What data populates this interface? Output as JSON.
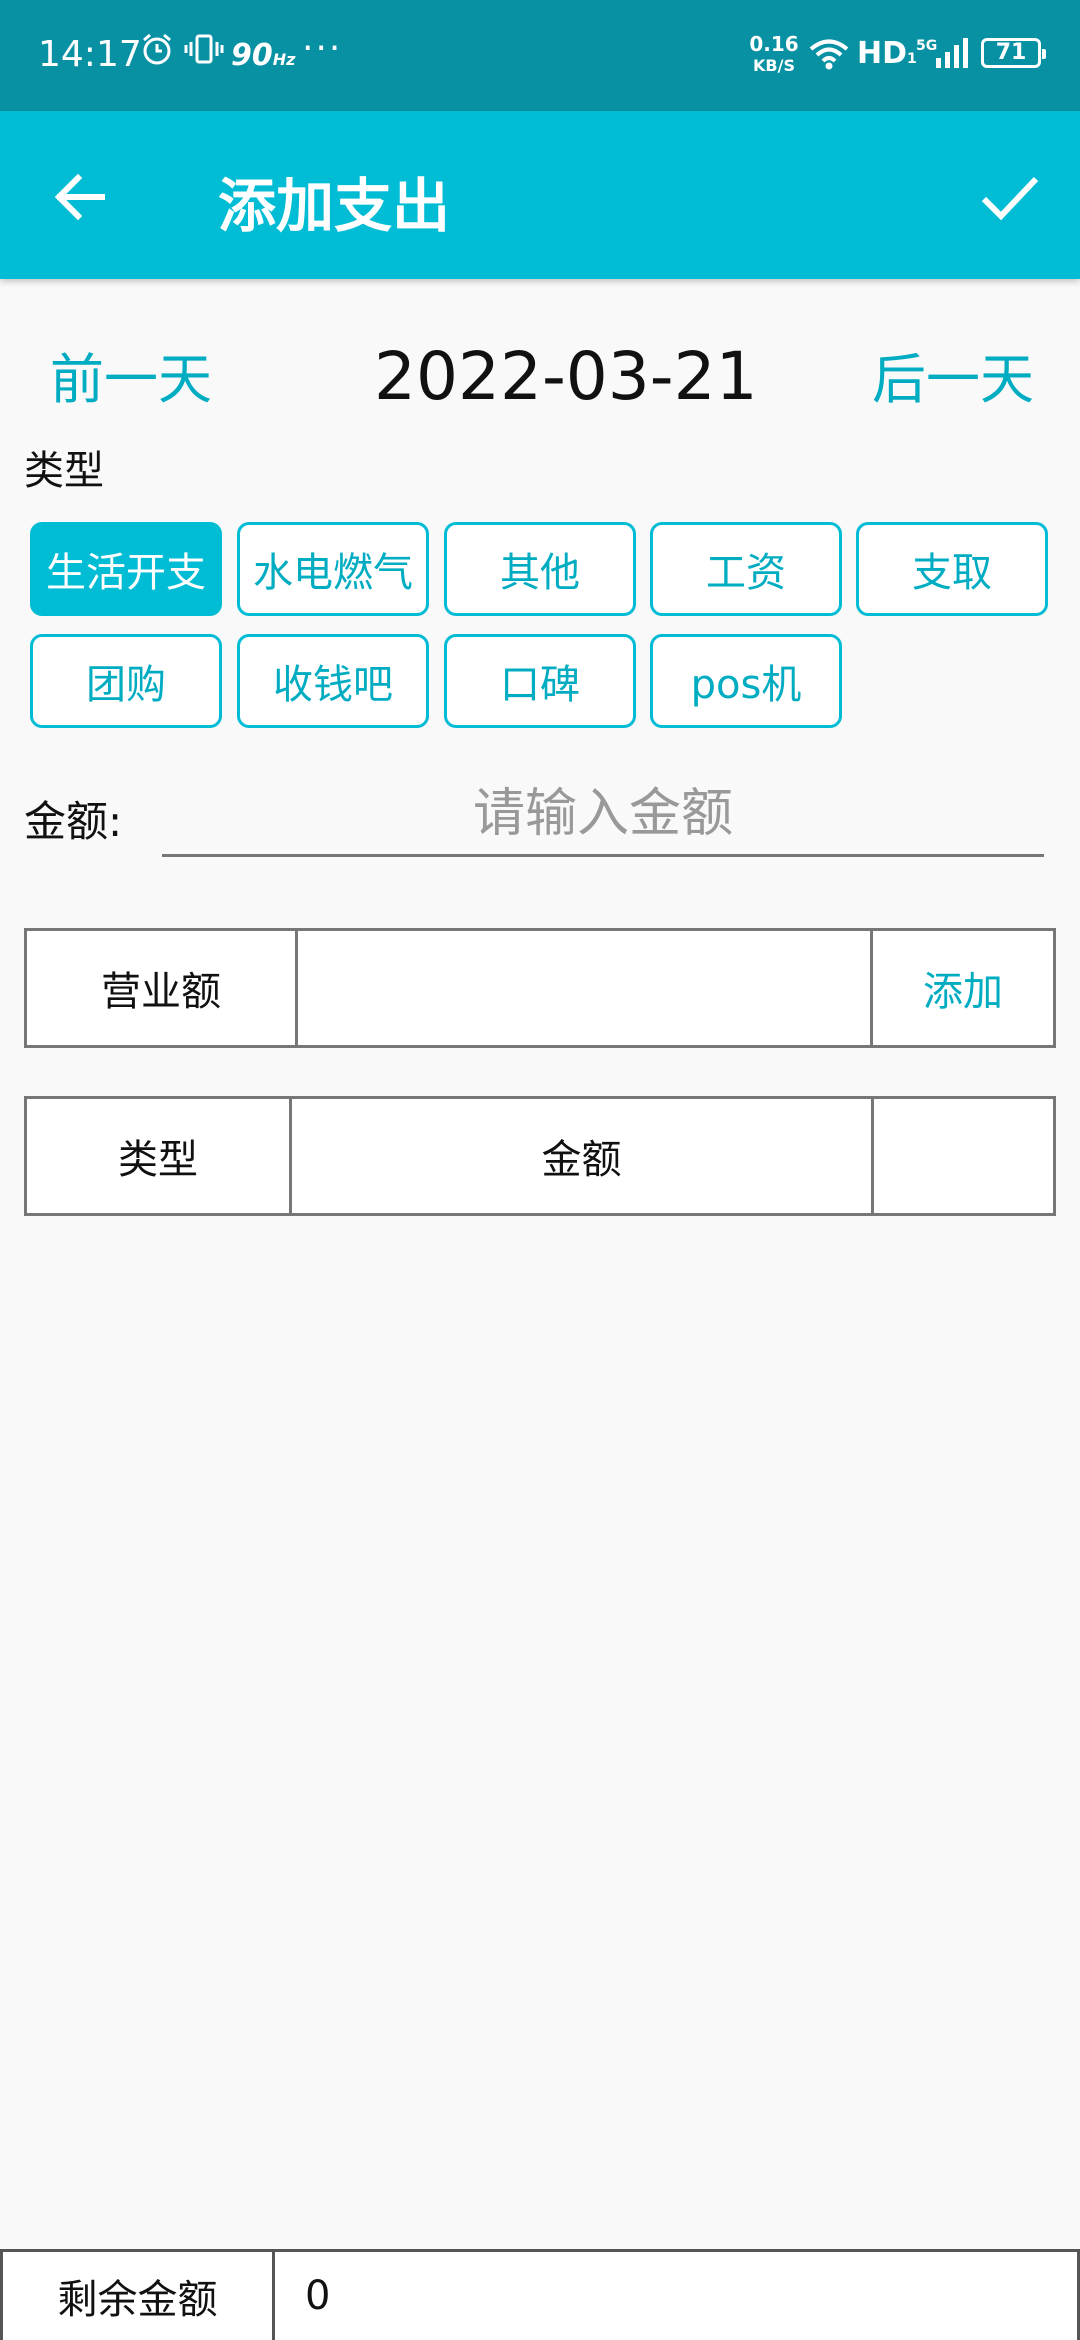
{
  "status_bar": {
    "time": "14:17",
    "refresh_rate": "90",
    "refresh_unit": "Hz",
    "more": "···",
    "speed_value": "0.16",
    "speed_unit": "KB/S",
    "hd_label": "HD",
    "hd_sub": "1",
    "network_type": "5G",
    "battery": "71",
    "icons": [
      "alarm-icon",
      "vibrate-icon",
      "wifi-icon",
      "signal-icon",
      "battery-icon"
    ]
  },
  "app_bar": {
    "title": "添加支出",
    "back_icon": "arrow-left-icon",
    "confirm_icon": "check-icon"
  },
  "date_nav": {
    "prev_label": "前一天",
    "date": "2022-03-21",
    "next_label": "后一天"
  },
  "type_section": {
    "label": "类型",
    "chips": [
      {
        "label": "生活开支",
        "selected": true
      },
      {
        "label": "水电燃气",
        "selected": false
      },
      {
        "label": "其他",
        "selected": false
      },
      {
        "label": "工资",
        "selected": false
      },
      {
        "label": "支取",
        "selected": false
      },
      {
        "label": "团购",
        "selected": false
      },
      {
        "label": "收钱吧",
        "selected": false
      },
      {
        "label": "口碑",
        "selected": false
      },
      {
        "label": "pos机",
        "selected": false
      }
    ]
  },
  "amount": {
    "label": "金额:",
    "placeholder": "请输入金额",
    "value": ""
  },
  "revenue_row": {
    "label": "营业额",
    "value": "",
    "add_label": "添加"
  },
  "list_header": {
    "col_type": "类型",
    "col_amount": "金额",
    "col_action": ""
  },
  "remaining": {
    "label": "剩余金额",
    "value": "0"
  },
  "colors": {
    "status_bar": "#0891a3",
    "primary": "#00bcd4",
    "accent_text": "#00acc1",
    "background": "#f9f9f9"
  }
}
